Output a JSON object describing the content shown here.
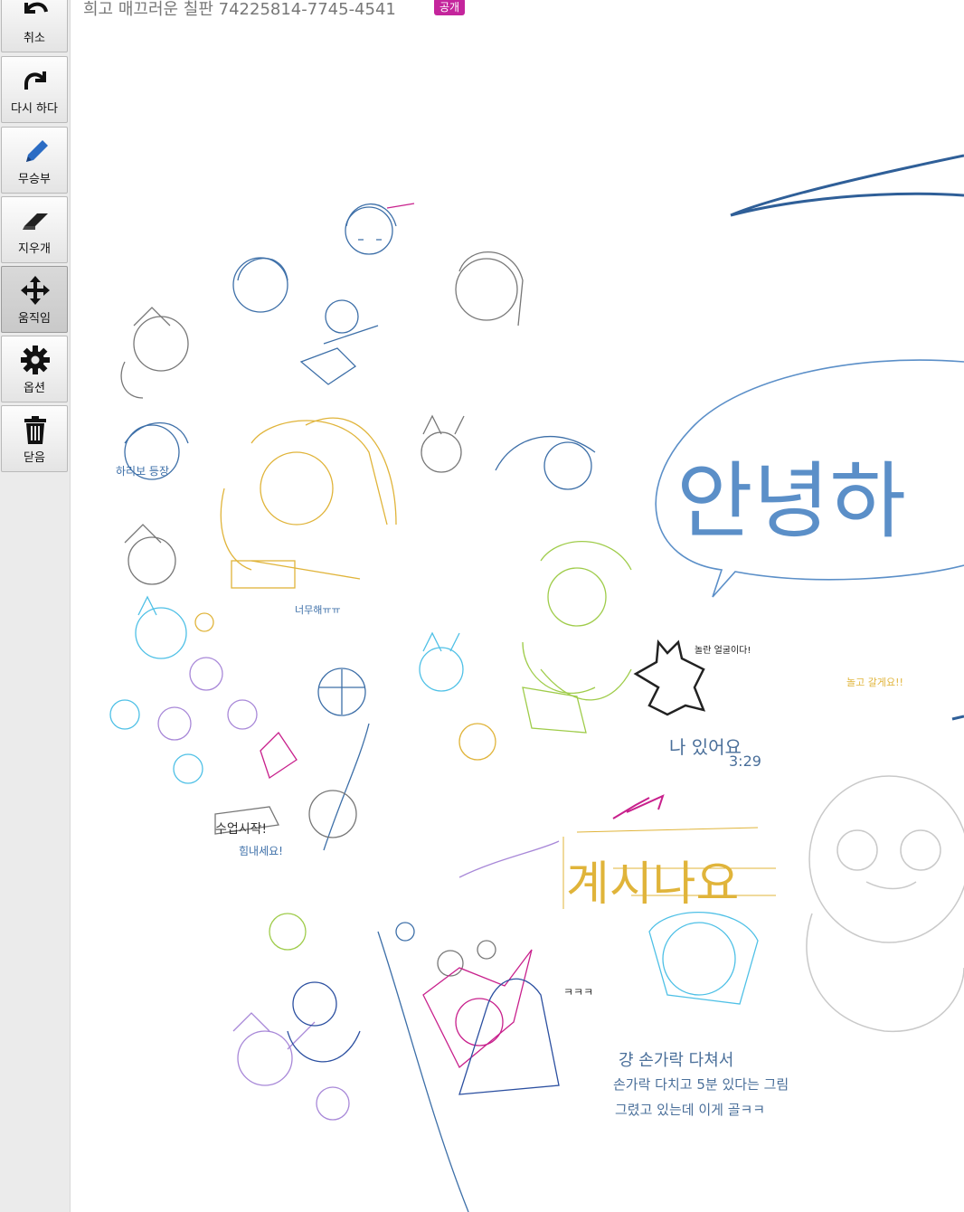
{
  "toolbar": {
    "tools": [
      {
        "id": "undo",
        "label": "취소",
        "icon": "undo-icon"
      },
      {
        "id": "redo",
        "label": "다시 하다",
        "icon": "redo-icon"
      },
      {
        "id": "pen",
        "label": "무승부",
        "icon": "pencil-icon"
      },
      {
        "id": "eraser",
        "label": "지우개",
        "icon": "eraser-icon"
      },
      {
        "id": "move",
        "label": "움직임",
        "icon": "move-arrows-icon",
        "active": true
      },
      {
        "id": "options",
        "label": "옵션",
        "icon": "gear-icon"
      },
      {
        "id": "close",
        "label": "닫음",
        "icon": "trash-icon"
      }
    ]
  },
  "header": {
    "title": "희고 매끄러운 칠판 74225814-7745-4541",
    "badge": "공개"
  },
  "canvas": {
    "greeting": "안녕하",
    "labels": {
      "welcome": "계시나요",
      "here": "나 있어요",
      "time": "3:29",
      "first_line": "걍 손가락 다쳐서",
      "second_line": "손가락 다치고 5분 있다는 그림",
      "third_line": "그렸고 있는데 이게 골ㅋㅋ",
      "laugh": "ㅋㅋㅋ",
      "stay": "놀고 갈게요!!",
      "shout": "너무해ㅠㅠ",
      "start": "수업시작!",
      "fighting": "힘내세요!",
      "friend": "하리보 등장",
      "ask": "놀란 얼굴이다!"
    },
    "colors": {
      "blue_ink": "#3d6fa8",
      "gold_ink": "#e0b43a",
      "magenta_ink": "#c8208c",
      "green_ink": "#9fcc4a",
      "cyan_ink": "#4ec0e6",
      "purple_ink": "#a888d8",
      "gray_ink": "#8a8a8a",
      "black_ink": "#222222",
      "badge": "#c4259c"
    }
  }
}
